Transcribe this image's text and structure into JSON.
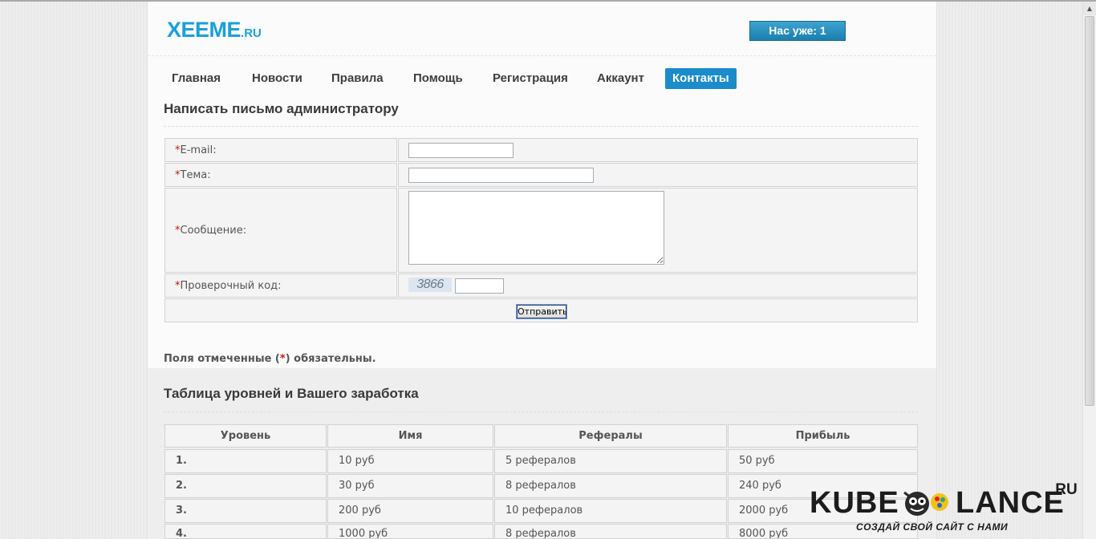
{
  "site": {
    "logo_main": "XEEME",
    "logo_suffix": ".RU",
    "users_badge": "Нас уже: 1"
  },
  "nav": {
    "items": [
      {
        "label": "Главная"
      },
      {
        "label": "Новости"
      },
      {
        "label": "Правила"
      },
      {
        "label": "Помощь"
      },
      {
        "label": "Регистрация"
      },
      {
        "label": "Аккаунт"
      },
      {
        "label": "Контакты",
        "active": true
      }
    ]
  },
  "contact_form": {
    "title": "Написать письмо администратору",
    "required_mark": "*",
    "fields": {
      "email_label": "E-mail:",
      "email_value": "",
      "subject_label": "Тема:",
      "subject_value": "",
      "message_label": "Сообщение:",
      "message_value": "",
      "captcha_label": "Проверочный код:",
      "captcha_code": "3866",
      "captcha_value": ""
    },
    "submit_label": "Отправить",
    "note_prefix": "Поля отмеченные (",
    "note_suffix": ") обязательны."
  },
  "levels_table": {
    "title": "Таблица уровней и Вашего заработка",
    "headers": [
      "Уровень",
      "Имя",
      "Рефералы",
      "Прибыль"
    ],
    "rows": [
      [
        "1.",
        "10 руб",
        "5 рефералов",
        "50 руб"
      ],
      [
        "2.",
        "30 руб",
        "8 рефералов",
        "240 руб"
      ],
      [
        "3.",
        "200 руб",
        "10 рефералов",
        "2000 руб"
      ],
      [
        "4.",
        "1000 руб",
        "8 рефералов",
        "8000 руб"
      ]
    ]
  },
  "watermark": {
    "part1": "KUBE",
    "part2": "LANCE",
    "domain": ".RU",
    "tagline": "СОЗДАЙ СВОЙ САЙТ С НАМИ"
  },
  "colors": {
    "accent": "#1a8ccb",
    "logo": "#1aa0db",
    "required": "#c91515"
  }
}
